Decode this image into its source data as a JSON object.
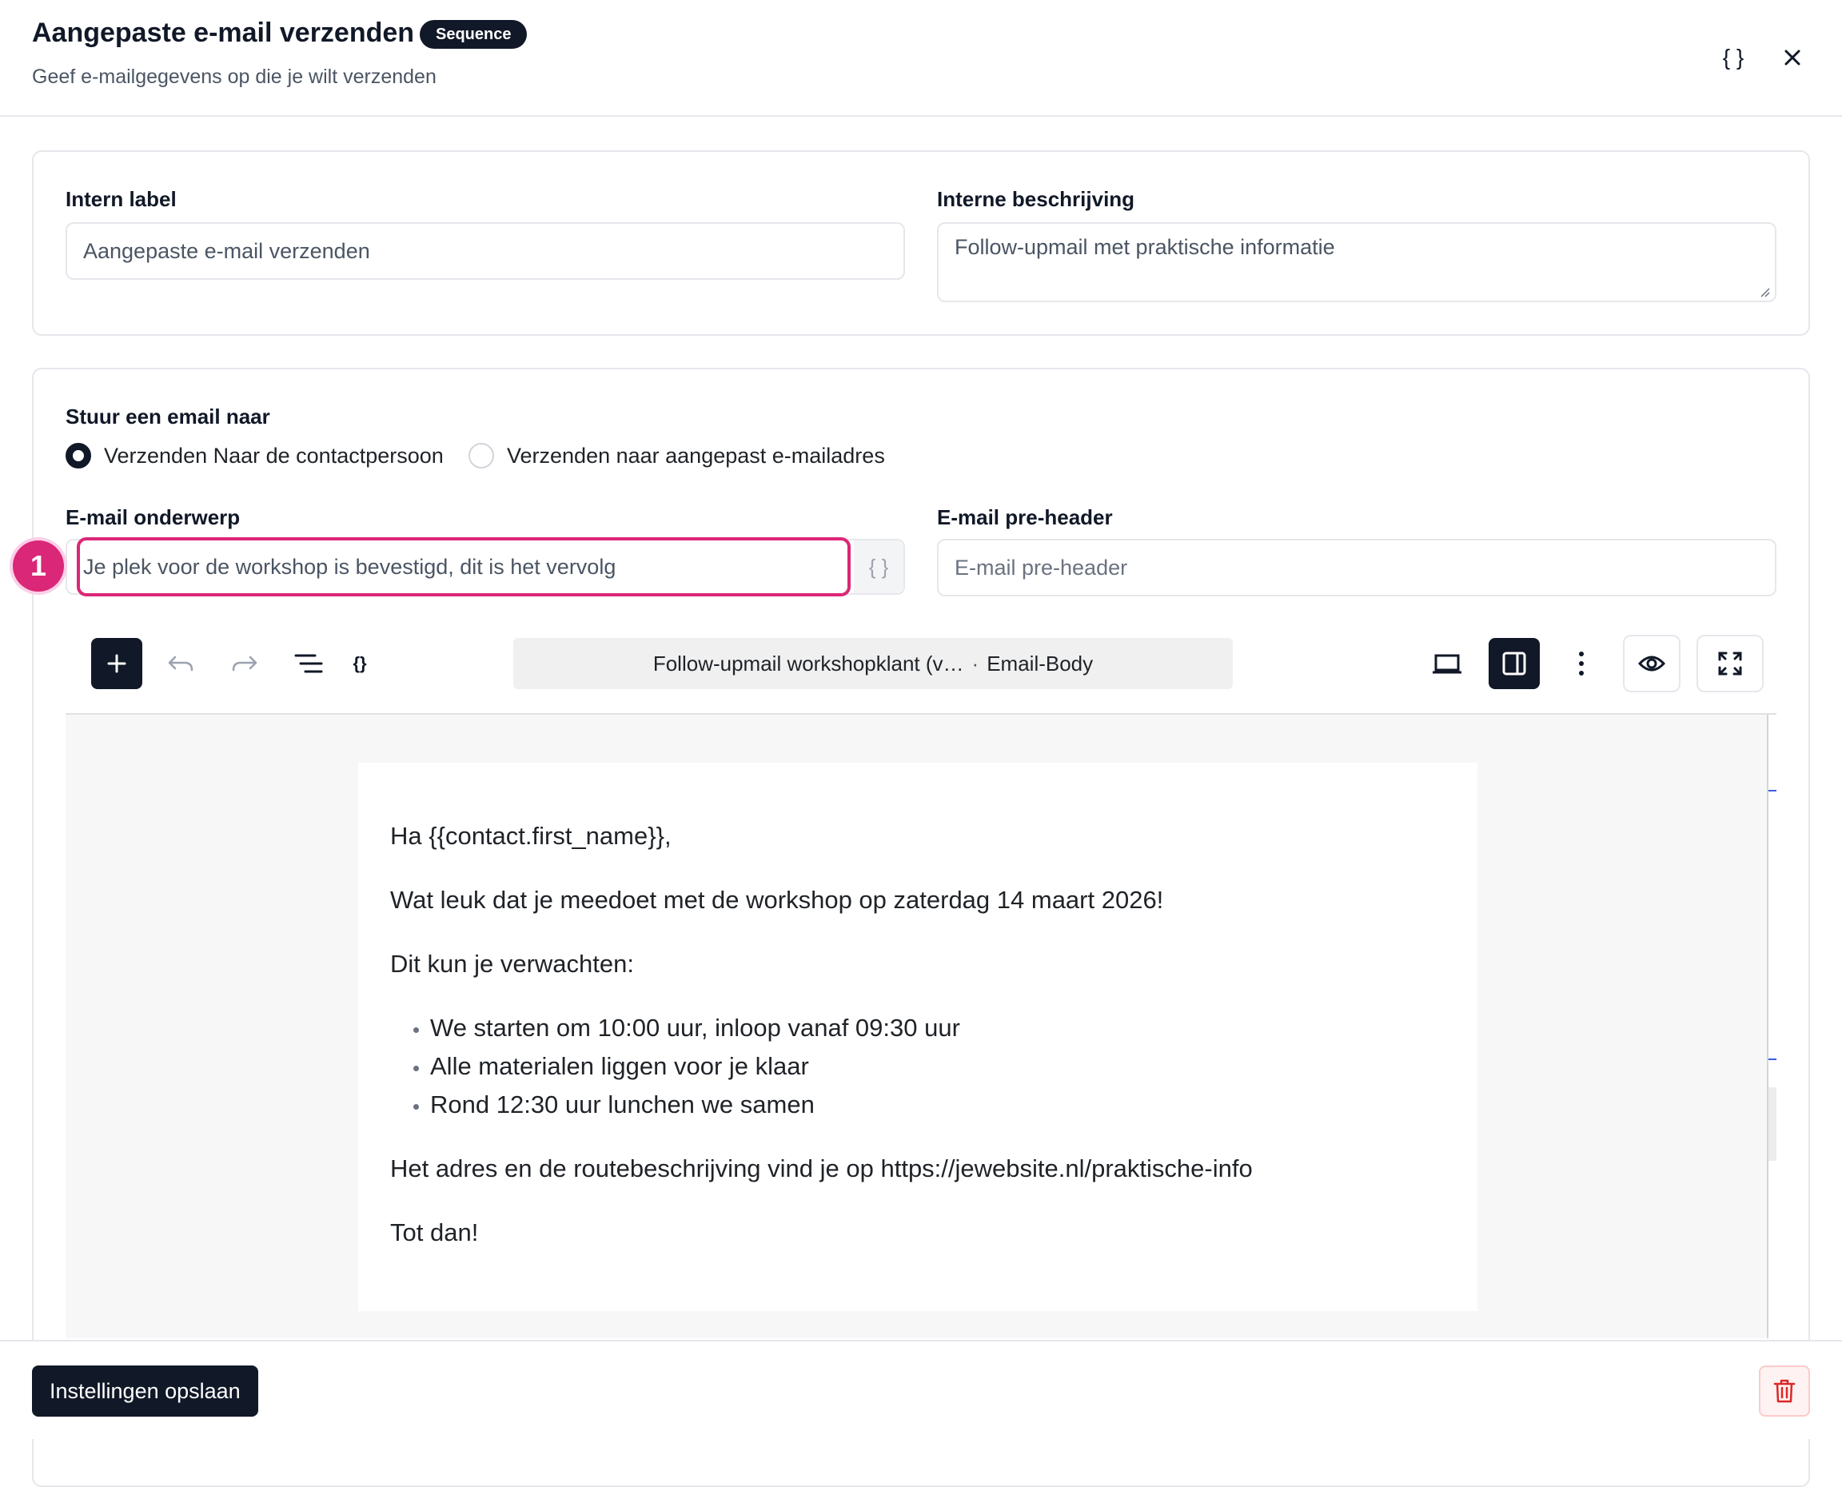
{
  "dialog": {
    "title": "Aangepaste e-mail verzenden",
    "badge": "Sequence",
    "subtitle": "Geef e-mailgegevens op die je wilt verzenden",
    "variables_icon": "{ }",
    "close_icon": "close-icon"
  },
  "details": {
    "internal_label": {
      "label": "Intern label",
      "value": "Aangepaste e-mail verzenden"
    },
    "internal_description": {
      "label": "Interne beschrijving",
      "value": "Follow-upmail met praktische informatie"
    }
  },
  "recipient": {
    "label": "Stuur een email naar",
    "options": [
      {
        "label": "Verzenden Naar de contactpersoon",
        "selected": true
      },
      {
        "label": "Verzenden naar aangepast e-mailadres",
        "selected": false
      }
    ]
  },
  "subject": {
    "label": "E-mail onderwerp",
    "value": "Je plek voor de workshop is bevestigd, dit is het vervolg",
    "merge_tags_icon": "{ }",
    "step_marker": "1",
    "highlight_color": "#db2777"
  },
  "preheader": {
    "label": "E-mail pre-header",
    "placeholder": "E-mail pre-header"
  },
  "editor_toolbar": {
    "add_icon": "plus-icon",
    "undo_icon": "undo-icon",
    "redo_icon": "redo-icon",
    "outline_icon": "list-view-icon",
    "variables_icon": "{}",
    "document_title": "Follow-upmail workshopklant (v…",
    "document_separator": "·",
    "document_part": "Email-Body",
    "desktop_icon": "laptop-icon",
    "sidebar_icon": "sidebar-toggle-icon",
    "more_icon": "more-vertical-icon",
    "preview_icon": "eye-icon",
    "fullscreen_icon": "fullscreen-icon"
  },
  "email_body": {
    "greeting": "Ha {{contact.first_name}},",
    "intro": "Wat leuk dat je meedoet met de workshop op zaterdag 14 maart 2026!",
    "expect_heading": "Dit kun je verwachten:",
    "bullets": [
      "We starten om 10:00 uur, inloop vanaf 09:30 uur",
      "Alle materialen liggen voor je klaar",
      "Rond 12:30 uur lunchen we samen"
    ],
    "address_line": "Het adres en de routebeschrijving vind je op https://jewebsite.nl/praktische-info",
    "closing": "Tot dan!"
  },
  "footer": {
    "save_label": "Instellingen opslaan",
    "delete_icon": "trash-icon",
    "delete_color": "#dc2626"
  }
}
